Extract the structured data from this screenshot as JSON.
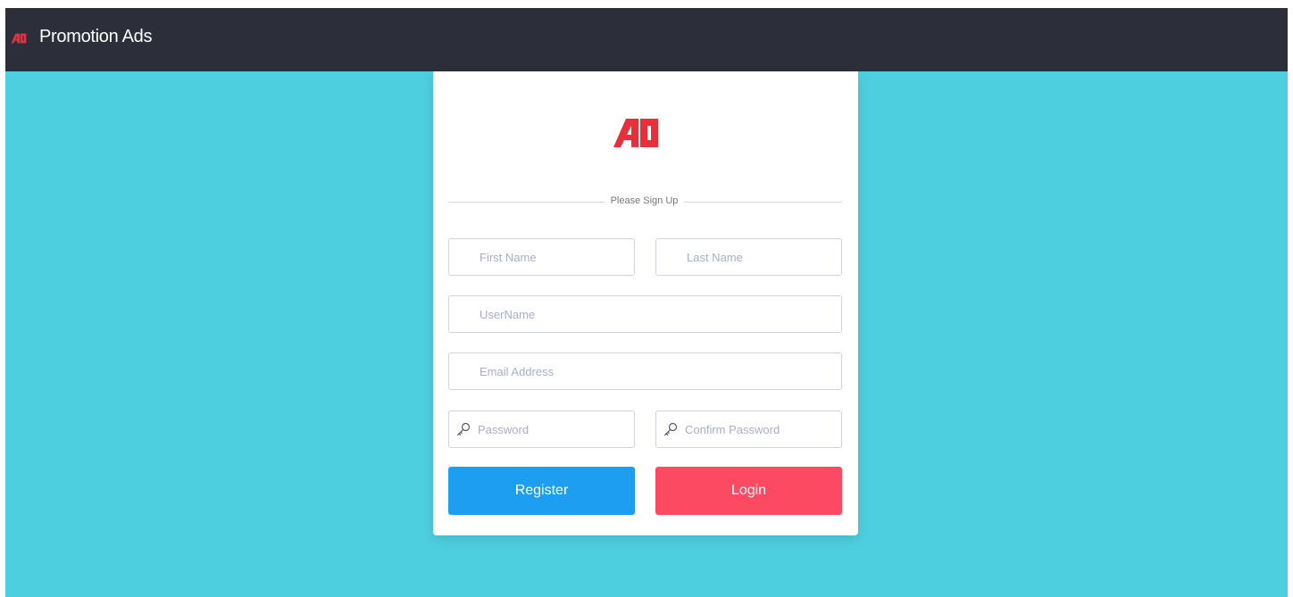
{
  "navbar": {
    "brand_icon": "ad-logo-icon",
    "title": "Promotion Ads"
  },
  "card": {
    "logo_icon": "ad-logo-icon",
    "heading": "Please Sign Up",
    "fields": {
      "first_name": {
        "placeholder": "First Name",
        "value": ""
      },
      "last_name": {
        "placeholder": "Last Name",
        "value": ""
      },
      "username": {
        "placeholder": "UserName",
        "value": ""
      },
      "email": {
        "placeholder": "Email Address",
        "value": ""
      },
      "password": {
        "placeholder": "Password",
        "value": "",
        "icon": "key-icon"
      },
      "confirm_password": {
        "placeholder": "Confirm Password",
        "value": "",
        "icon": "key-icon"
      }
    },
    "buttons": {
      "register": "Register",
      "login": "Login"
    }
  },
  "colors": {
    "navbar_bg": "#2c2f3a",
    "page_bg": "#4ecfe0",
    "brand_red": "#e8303d",
    "register": "#1e9ef0",
    "login": "#fc4a63"
  }
}
